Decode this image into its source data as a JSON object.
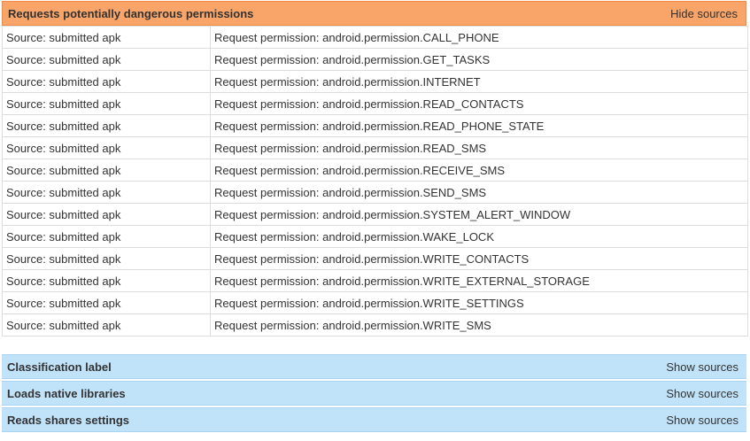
{
  "dangerous_permissions": {
    "title": "Requests potentially dangerous permissions",
    "toggle_label": "Hide sources",
    "rows": [
      {
        "source": "Source: submitted apk",
        "detail": "Request permission: android.permission.CALL_PHONE"
      },
      {
        "source": "Source: submitted apk",
        "detail": "Request permission: android.permission.GET_TASKS"
      },
      {
        "source": "Source: submitted apk",
        "detail": "Request permission: android.permission.INTERNET"
      },
      {
        "source": "Source: submitted apk",
        "detail": "Request permission: android.permission.READ_CONTACTS"
      },
      {
        "source": "Source: submitted apk",
        "detail": "Request permission: android.permission.READ_PHONE_STATE"
      },
      {
        "source": "Source: submitted apk",
        "detail": "Request permission: android.permission.READ_SMS"
      },
      {
        "source": "Source: submitted apk",
        "detail": "Request permission: android.permission.RECEIVE_SMS"
      },
      {
        "source": "Source: submitted apk",
        "detail": "Request permission: android.permission.SEND_SMS"
      },
      {
        "source": "Source: submitted apk",
        "detail": "Request permission: android.permission.SYSTEM_ALERT_WINDOW"
      },
      {
        "source": "Source: submitted apk",
        "detail": "Request permission: android.permission.WAKE_LOCK"
      },
      {
        "source": "Source: submitted apk",
        "detail": "Request permission: android.permission.WRITE_CONTACTS"
      },
      {
        "source": "Source: submitted apk",
        "detail": "Request permission: android.permission.WRITE_EXTERNAL_STORAGE"
      },
      {
        "source": "Source: submitted apk",
        "detail": "Request permission: android.permission.WRITE_SETTINGS"
      },
      {
        "source": "Source: submitted apk",
        "detail": "Request permission: android.permission.WRITE_SMS"
      }
    ]
  },
  "collapsed_sections": [
    {
      "title": "Classification label",
      "toggle_label": "Show sources"
    },
    {
      "title": "Loads native libraries",
      "toggle_label": "Show sources"
    },
    {
      "title": "Reads shares settings",
      "toggle_label": "Show sources"
    }
  ],
  "colors": {
    "expanded_header_bg": "#f9a468",
    "collapsed_header_bg": "#c1e3fa",
    "row_border": "#dddddd",
    "text": "#333333"
  }
}
